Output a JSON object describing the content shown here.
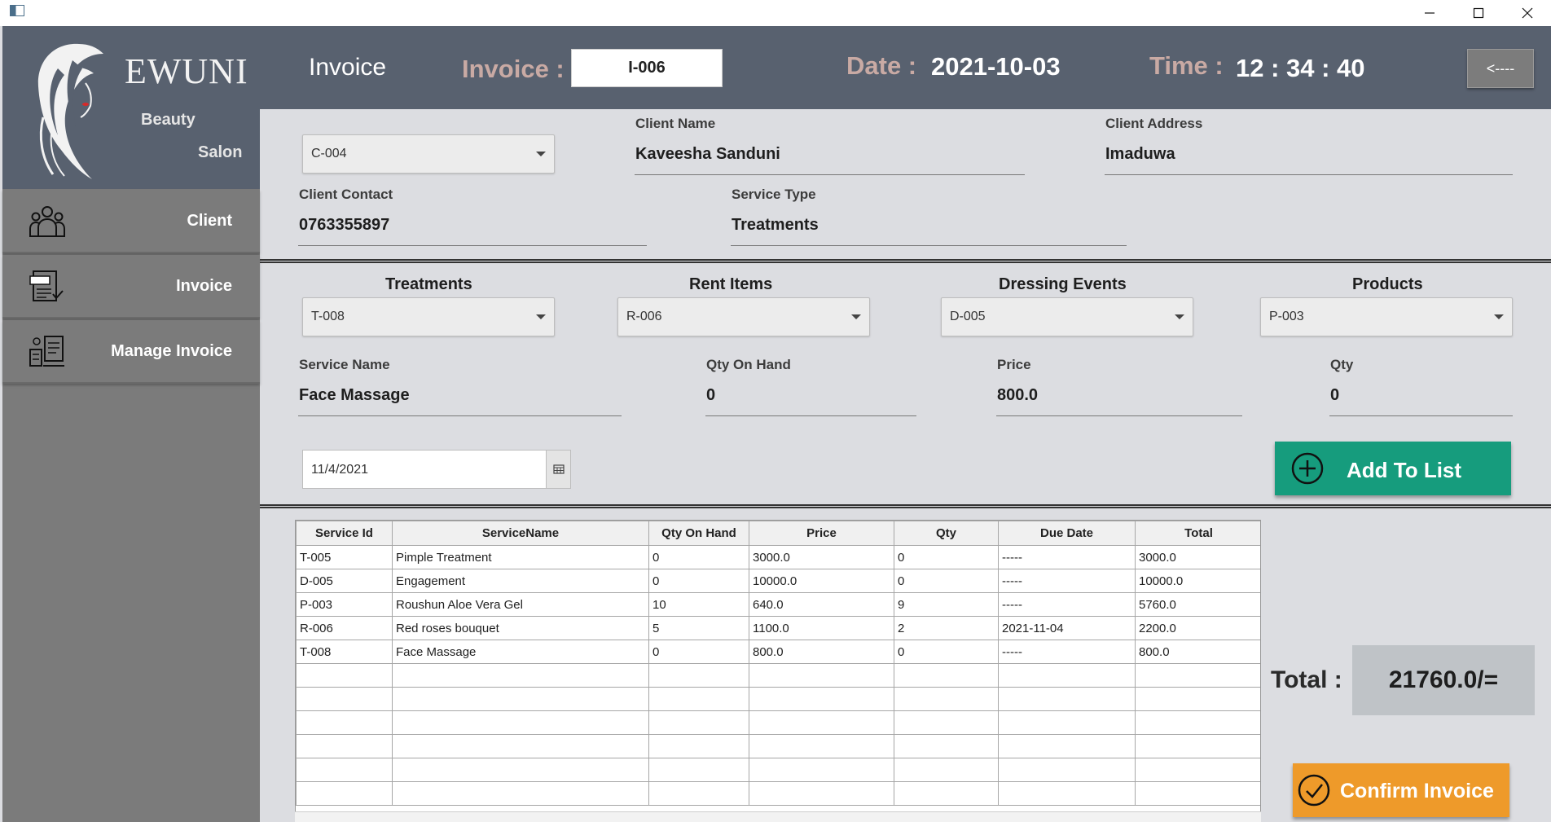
{
  "window": {
    "min_icon": "minimize-icon",
    "max_icon": "maximize-icon",
    "close_icon": "close-icon"
  },
  "brand": {
    "name": "EWUNI",
    "sub1": "Beauty",
    "sub2": "Salon"
  },
  "sidebar": {
    "items": [
      {
        "label": "Client",
        "icon": "users-icon"
      },
      {
        "label": "Invoice",
        "icon": "invoice-doc-icon"
      },
      {
        "label": "Manage Invoice",
        "icon": "manage-invoice-icon"
      }
    ]
  },
  "header": {
    "title": "Invoice",
    "invoice_label": "Invoice :",
    "invoice_id": "I-006",
    "date_label": "Date :",
    "date_value": "2021-10-03",
    "time_label": "Time :",
    "time_value": "12 : 34 : 40",
    "back_label": "<----"
  },
  "client": {
    "id_selected": "C-004",
    "name_label": "Client Name",
    "name_value": "Kaveesha Sanduni",
    "address_label": "Client Address",
    "address_value": "Imaduwa",
    "contact_label": "Client Contact",
    "contact_value": "0763355897",
    "service_type_label": "Service Type",
    "service_type_value": "Treatments"
  },
  "services": {
    "treatments_label": "Treatments",
    "treatments_selected": "T-008",
    "rent_label": "Rent Items",
    "rent_selected": "R-006",
    "dressing_label": "Dressing Events",
    "dressing_selected": "D-005",
    "products_label": "Products",
    "products_selected": "P-003",
    "service_name_label": "Service Name",
    "service_name_value": "Face Massage",
    "qoh_label": "Qty On Hand",
    "qoh_value": "0",
    "price_label": "Price",
    "price_value": "800.0",
    "qty_label": "Qty",
    "qty_value": "0",
    "date_value": "11/4/2021",
    "add_label": "Add To List"
  },
  "table": {
    "headers": [
      "Service Id",
      "ServiceName",
      "Qty On Hand",
      "Price",
      "Qty",
      "Due Date",
      "Total"
    ],
    "rows": [
      [
        "T-005",
        "Pimple Treatment",
        "0",
        "3000.0",
        "0",
        "-----",
        "3000.0"
      ],
      [
        "D-005",
        "Engagement",
        "0",
        "10000.0",
        "0",
        "-----",
        "10000.0"
      ],
      [
        "P-003",
        "Roushun Aloe Vera Gel",
        "10",
        "640.0",
        "9",
        "-----",
        "5760.0"
      ],
      [
        "R-006",
        "Red roses bouquet",
        "5",
        "1100.0",
        "2",
        "2021-11-04",
        "2200.0"
      ],
      [
        "T-008",
        "Face Massage",
        "0",
        "800.0",
        "0",
        "-----",
        "800.0"
      ]
    ]
  },
  "summary": {
    "total_label": "Total :",
    "total_value": "21760.0/=",
    "confirm_label": "Confirm Invoice"
  }
}
